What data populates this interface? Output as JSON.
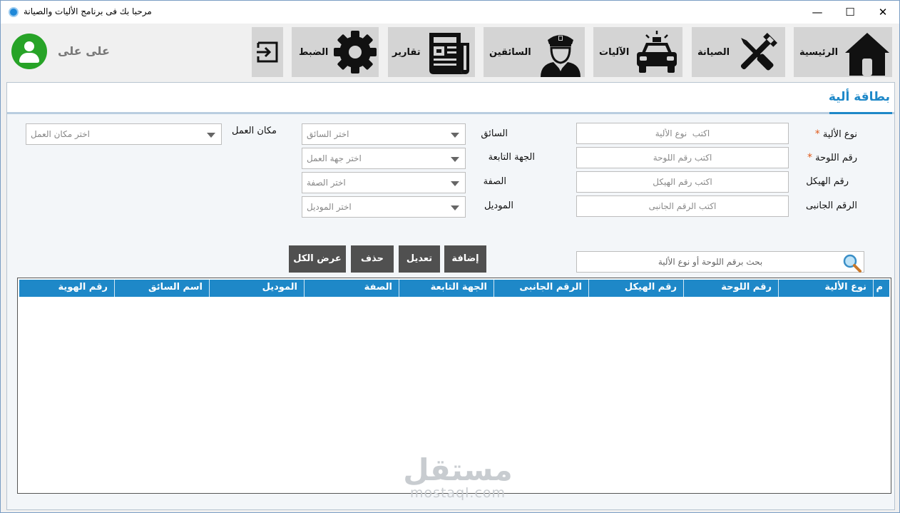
{
  "window": {
    "title": "مرحبا بك فى برنامج الأليات والصيانة",
    "controls": {
      "minimize": "—",
      "maximize": "☐",
      "close": "✕"
    }
  },
  "user": {
    "name": "على على"
  },
  "nav": {
    "home": "الرئيسية",
    "maintenance": "الصيانة",
    "vehicles": "الآليات",
    "drivers": "السائقين",
    "reports": "تقارير",
    "settings": "الضبط"
  },
  "panel": {
    "title": "بطاقة ألية"
  },
  "form": {
    "vehicle_type": {
      "label": "نوع الألية",
      "required": "*",
      "placeholder": "اكتب  نوع الألية"
    },
    "plate_number": {
      "label": "رقم اللوحة",
      "required": "*",
      "placeholder": "اكتب رقم اللوحة"
    },
    "chassis_number": {
      "label": "رقم الهيكل",
      "placeholder": "اكتب رقم الهيكل"
    },
    "side_number": {
      "label": "الرقم الجانبى",
      "placeholder": "اكتب الرقم الجانبى"
    },
    "driver": {
      "label": "السائق",
      "placeholder": "اختر السائق"
    },
    "department": {
      "label": "الجهة التابعة",
      "placeholder": "اختر جهة العمل"
    },
    "category": {
      "label": "الصفة",
      "placeholder": "اختر الصفة"
    },
    "model": {
      "label": "الموديل",
      "placeholder": "اختر الموديل"
    },
    "workplace": {
      "label": "مكان العمل",
      "placeholder": "اختر مكان العمل"
    }
  },
  "actions": {
    "add": "إضافة",
    "edit": "تعديل",
    "delete": "حذف",
    "show_all": "عرض الكل"
  },
  "search": {
    "placeholder": "بحث برقم اللوحة أو نوع الألية"
  },
  "table": {
    "columns": [
      "م",
      "نوع الألية",
      "رقم اللوحة",
      "رقم الهيكل",
      "الرقم الجانبى",
      "الجهة التابعة",
      "الصفة",
      "الموديل",
      "اسم السائق",
      "رقم الهوية"
    ],
    "rows": []
  },
  "watermark": {
    "arabic": "مستقل",
    "latin": "mostaql.com"
  },
  "colors": {
    "accent": "#1e88c8",
    "nav_bg": "#d4d4d4",
    "action_bg": "#505050",
    "avatar": "#27a327",
    "required": "#e05a1a"
  }
}
